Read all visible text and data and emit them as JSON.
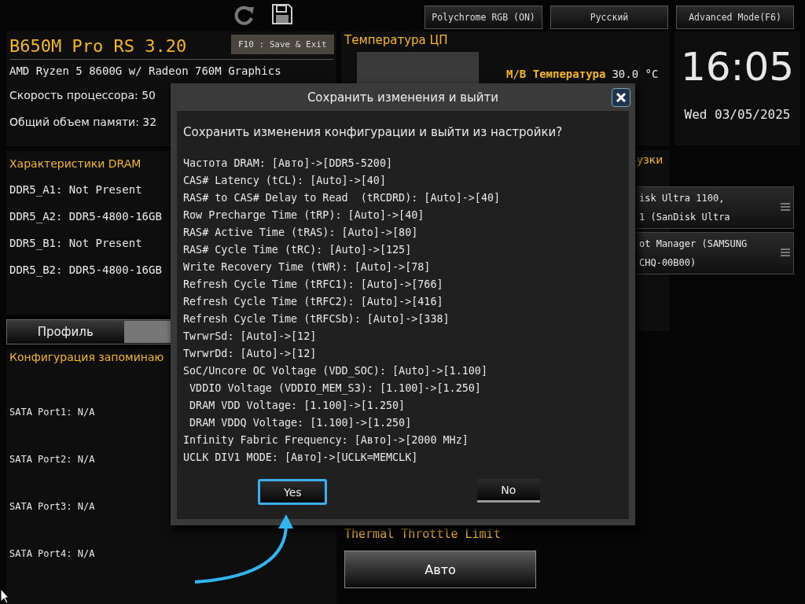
{
  "toolbar": {
    "tooltip": "F10 : Save & Exit",
    "buttons": [
      "Polychrome RGB (ON)",
      "Русский",
      "Advanced Mode(F6)"
    ]
  },
  "system": {
    "title": "B650M Pro RS 3.20",
    "lines": [
      "AMD Ryzen 5 8600G w/ Radeon 760M Graphics",
      "Скорость процессора: 50",
      "Общий объем памяти: 32"
    ]
  },
  "dram": {
    "title": "Характеристики DRAM",
    "slots": [
      "DDR5_A1: Not Present",
      "DDR5_A2: DDR5-4800-16GB",
      "DDR5_B1: Not Present",
      "DDR5_B2: DDR5-4800-16GB"
    ]
  },
  "profile": {
    "label": "Профиль"
  },
  "storage": {
    "title": "Конфигурация запоминаю",
    "ports": [
      "SATA Port1: N/A",
      "SATA Port2: N/A",
      "SATA Port3: N/A",
      "SATA Port4: N/A"
    ]
  },
  "cpu_temp": {
    "title": "Температура ЦП",
    "mb_label": "M/B Температура",
    "mb_value": "30.0 °C"
  },
  "clock": {
    "time": "16:05",
    "date": "Wed 03/05/2025"
  },
  "boot": {
    "title": "узки",
    "items": [
      {
        "lines": [
          "isk Ultra 1100,",
          "1 (SanDisk Ultra"
        ]
      },
      {
        "lines": [
          "ot Manager (SAMSUNG",
          "CHQ-00B00)"
        ]
      }
    ]
  },
  "thermal": {
    "title": "Thermal Throttle Limit",
    "value": "Авто"
  },
  "dialog": {
    "title": "Сохранить изменения и выйти",
    "question": "Сохранить изменения конфигурации и выйти из настройки?",
    "changes": [
      "Частота DRAM: [Авто]->[DDR5-5200]",
      "CAS# Latency (tCL): [Auto]->[40]",
      "RAS# to CAS# Delay to Read  (tRCDRD): [Auto]->[40]",
      "Row Precharge Time (tRP): [Auto]->[40]",
      "RAS# Active Time (tRAS): [Auto]->[80]",
      "RAS# Cycle Time (tRC): [Auto]->[125]",
      "Write Recovery Time (tWR): [Auto]->[78]",
      "Refresh Cycle Time (tRFC1): [Auto]->[766]",
      "Refresh Cycle Time (tRFC2): [Auto]->[416]",
      "Refresh Cycle Time (tRFCSb): [Auto]->[338]",
      "TwrwrSd: [Auto]->[12]",
      "TwrwrDd: [Auto]->[12]",
      "SoC/Uncore OC Voltage (VDD_SOC): [Auto]->[1.100]",
      " VDDIO Voltage (VDDIO_MEM_S3): [1.100]->[1.250]",
      " DRAM VDD Voltage: [1.100]->[1.250]",
      " DRAM VDDQ Voltage: [1.100]->[1.250]",
      "Infinity Fabric Frequency: [Авто]->[2000 MHz]",
      "UCLK DIV1 MODE: [Авто]->[UCLK=MEMCLK]"
    ],
    "buttons": [
      {
        "label": "Yes",
        "selected": true
      },
      {
        "label": "No",
        "selected": false
      }
    ]
  }
}
